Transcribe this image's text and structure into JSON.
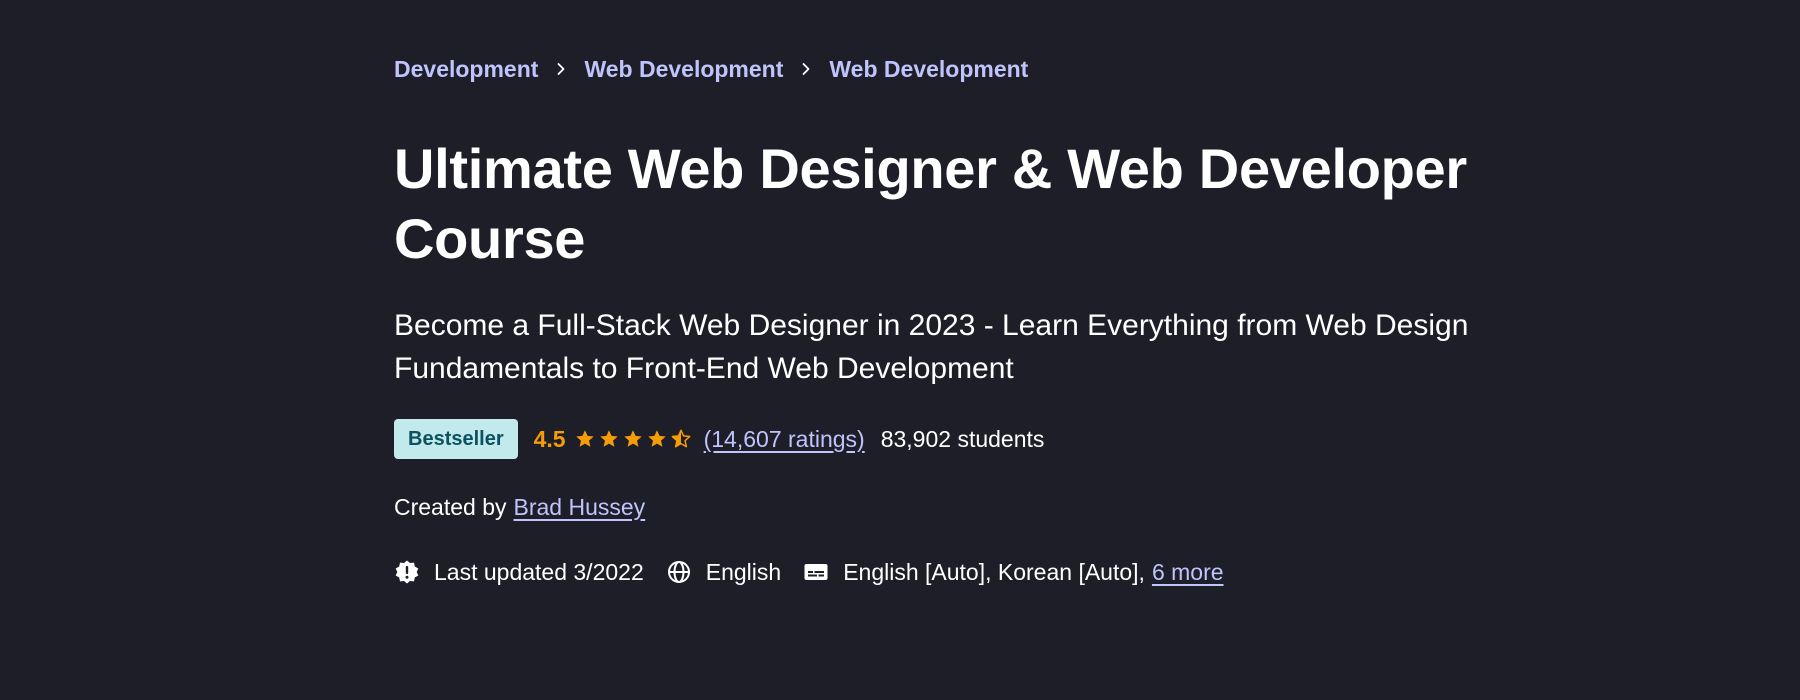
{
  "breadcrumb": {
    "items": [
      {
        "label": "Development"
      },
      {
        "label": "Web Development"
      },
      {
        "label": "Web Development"
      }
    ]
  },
  "course": {
    "title": "Ultimate Web Designer & Web Developer Course",
    "subtitle": "Become a Full-Stack Web Designer in 2023 - Learn Everything from Web Design Fundamentals to Front-End Web Development",
    "badge": "Bestseller",
    "rating": "4.5",
    "rating_stars": 4.5,
    "ratings_count": "(14,607 ratings)",
    "students": "83,902 students",
    "created_by_label": "Created by",
    "instructor": "Brad Hussey",
    "last_updated": "Last updated 3/2022",
    "language": "English",
    "captions": "English [Auto], Korean [Auto],",
    "captions_more": "6 more"
  },
  "colors": {
    "background": "#1d1e27",
    "link": "#c0c4fc",
    "rating": "#f69c08",
    "badge_bg": "#c2e9eb",
    "badge_text": "#0d5261"
  },
  "icons": {
    "breadcrumb_separator": "chevron-right-icon",
    "star": "star-icon",
    "updated": "alert-badge-icon",
    "language": "globe-icon",
    "captions": "closed-captions-icon"
  }
}
